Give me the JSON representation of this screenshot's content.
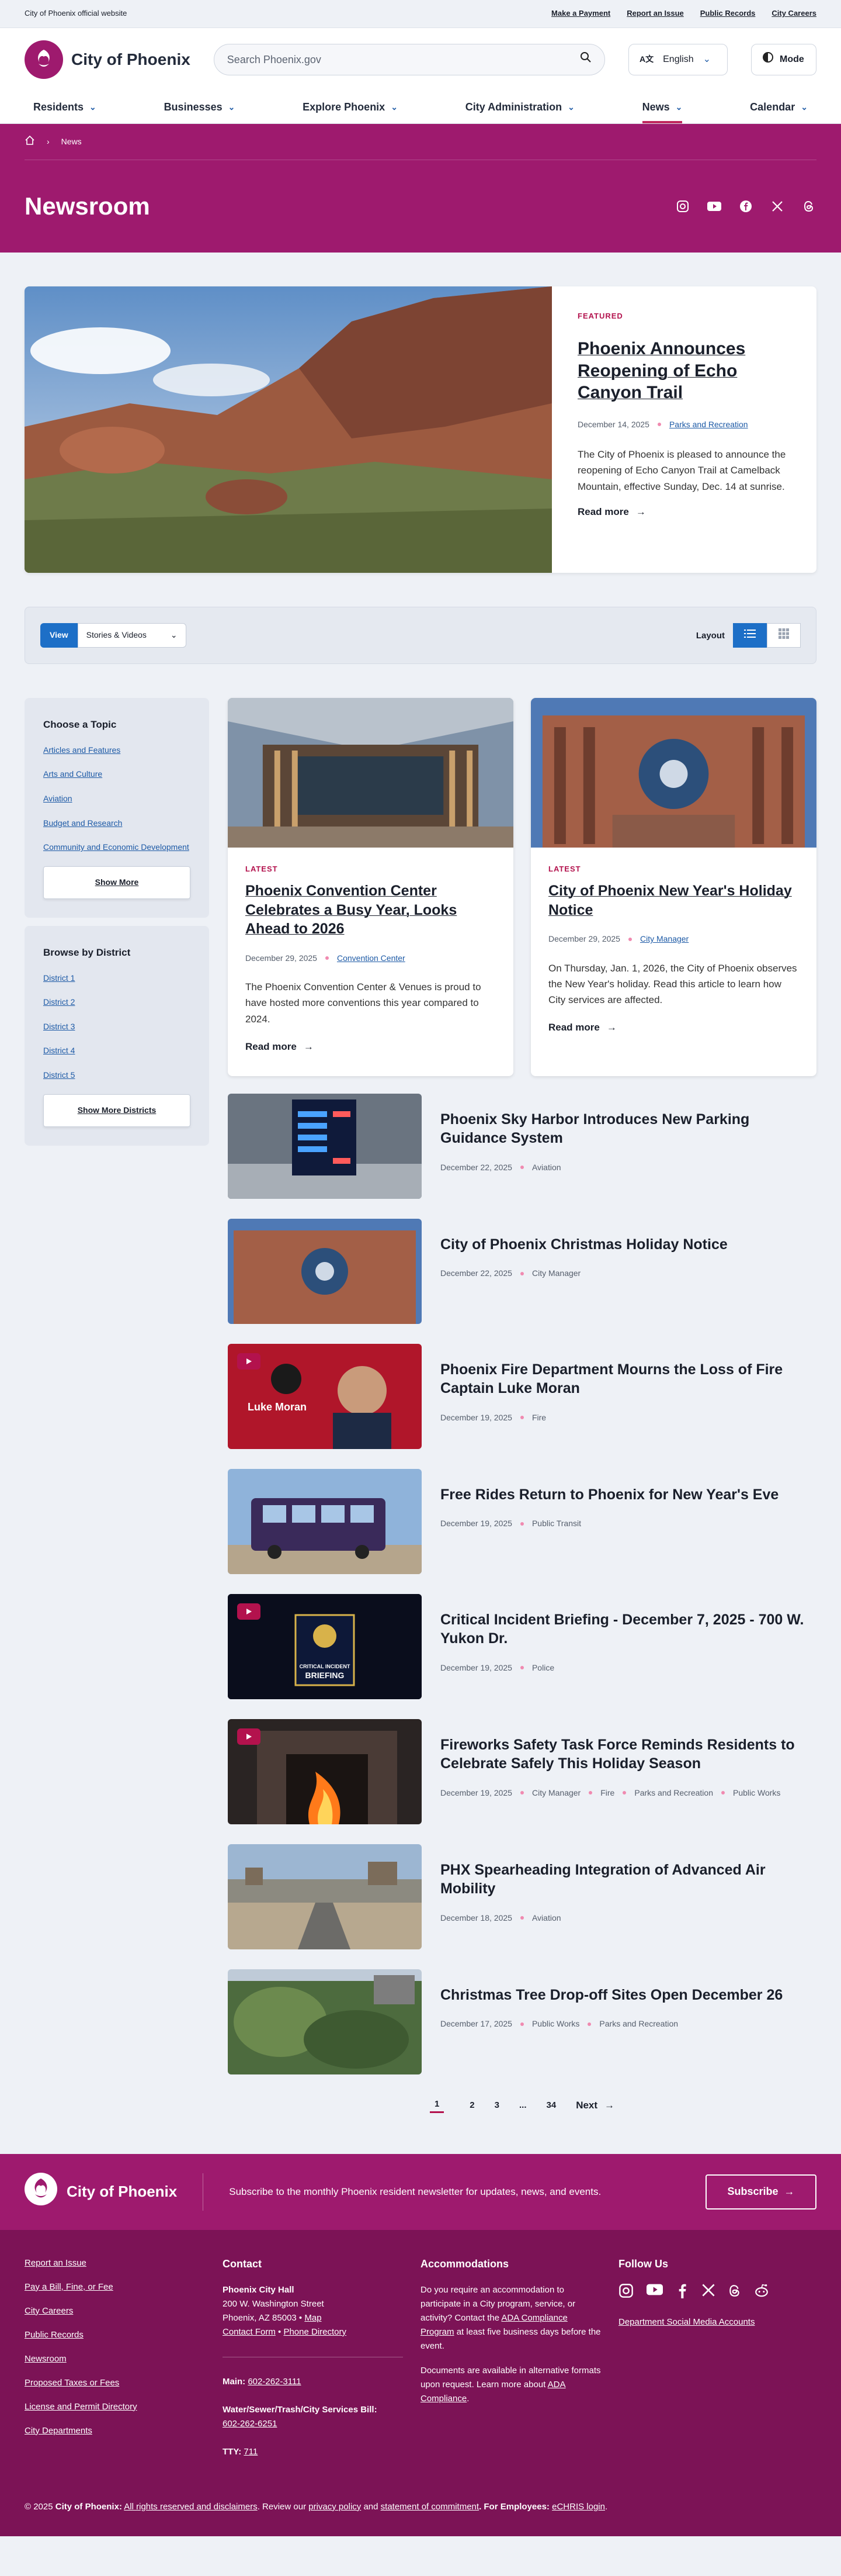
{
  "utility": {
    "official": "City of Phoenix official website",
    "links": [
      "Make a Payment",
      "Report an Issue",
      "Public Records",
      "City Careers"
    ]
  },
  "header": {
    "logo_text": "City of Phoenix",
    "search_placeholder": "Search Phoenix.gov",
    "language": "English",
    "mode_label": "Mode"
  },
  "nav": [
    "Residents",
    "Businesses",
    "Explore Phoenix",
    "City Administration",
    "News",
    "Calendar"
  ],
  "hero": {
    "crumb": "News",
    "title": "Newsroom"
  },
  "featured": {
    "badge": "FEATURED",
    "title": "Phoenix Announces Reopening of Echo Canyon Trail",
    "date": "December 14, 2025",
    "tag": "Parks and Recreation",
    "desc": "The City of Phoenix is pleased to announce the reopening of Echo Canyon Trail at Camelback Mountain, effective Sunday, Dec. 14 at sunrise.",
    "read_more": "Read more"
  },
  "filter": {
    "view_label": "View",
    "view_value": "Stories & Videos",
    "layout_label": "Layout"
  },
  "topics": {
    "title": "Choose a Topic",
    "items": [
      "Articles and Features",
      "Arts and Culture",
      "Aviation",
      "Budget and Research",
      "Community and Economic Development"
    ],
    "button": "Show More"
  },
  "districts": {
    "title": "Browse by District",
    "items": [
      "District 1",
      "District 2",
      "District 3",
      "District 4",
      "District 5"
    ],
    "button": "Show More Districts"
  },
  "cards": [
    {
      "badge": "LATEST",
      "title": "Phoenix Convention Center Celebrates a Busy Year, Looks Ahead to 2026",
      "date": "December 29, 2025",
      "tag": "Convention Center",
      "desc": "The Phoenix Convention Center & Venues is proud to have hosted more conventions this year compared to 2024.",
      "read_more": "Read more"
    },
    {
      "badge": "LATEST",
      "title": "City of Phoenix New Year's Holiday Notice",
      "date": "December 29, 2025",
      "tag": "City Manager",
      "desc": "On Thursday, Jan. 1, 2026, the City of Phoenix observes the New Year's holiday. Read this article to learn how City services are affected.",
      "read_more": "Read more"
    }
  ],
  "list": [
    {
      "title": "Phoenix Sky Harbor Introduces New Parking Guidance System",
      "date": "December 22, 2025",
      "tags": [
        "Aviation"
      ]
    },
    {
      "title": "City of Phoenix Christmas Holiday Notice",
      "date": "December 22, 2025",
      "tags": [
        "City Manager"
      ]
    },
    {
      "title": "Phoenix Fire Department Mourns the Loss of Fire Captain Luke Moran",
      "date": "December 19, 2025",
      "tags": [
        "Fire"
      ],
      "thumb_text": "Luke Moran"
    },
    {
      "title": "Free Rides Return to Phoenix for New Year's Eve",
      "date": "December 19, 2025",
      "tags": [
        "Public Transit"
      ]
    },
    {
      "title": "Critical Incident Briefing - December 7, 2025 - 700 W. Yukon Dr.",
      "date": "December 19, 2025",
      "tags": [
        "Police"
      ],
      "thumb_text": "CRITICAL INCIDENT",
      "thumb_text2": "BRIEFING"
    },
    {
      "title": "Fireworks Safety Task Force Reminds Residents to Celebrate Safely This Holiday Season",
      "date": "December 19, 2025",
      "tags": [
        "City Manager",
        "Fire",
        "Parks and Recreation",
        "Public Works"
      ]
    },
    {
      "title": "PHX Spearheading Integration of Advanced Air Mobility",
      "date": "December 18, 2025",
      "tags": [
        "Aviation"
      ]
    },
    {
      "title": "Christmas Tree Drop-off Sites Open December 26",
      "date": "December 17, 2025",
      "tags": [
        "Public Works",
        "Parks and Recreation"
      ]
    }
  ],
  "pager": {
    "pages": [
      "1",
      "2",
      "3",
      "...",
      "34"
    ],
    "next": "Next"
  },
  "footer": {
    "logo_text": "City of Phoenix",
    "subscribe_msg": "Subscribe to the monthly Phoenix resident newsletter for updates, news, and events.",
    "subscribe_btn": "Subscribe",
    "links": [
      "Report an Issue",
      "Pay a Bill, Fine, or Fee",
      "City Careers",
      "Public Records",
      "Newsroom",
      "Proposed Taxes or Fees",
      "License and Permit Directory",
      "City Departments"
    ],
    "contact": {
      "heading": "Contact",
      "name": "Phoenix City Hall",
      "addr1": "200 W. Washington Street",
      "addr2": "Phoenix, AZ 85003",
      "map": "Map",
      "contact_form": "Contact Form",
      "phone_dir": "Phone Directory",
      "main_label": "Main:",
      "main_phone": "602-262-3111",
      "water_label": "Water/Sewer/Trash/City Services Bill:",
      "water_phone": "602-262-6251",
      "tty_label": "TTY:",
      "tty": "711"
    },
    "accommodations": {
      "heading": "Accommodations",
      "p1": "Do you require an accommodation to participate in a City program, service, or activity? Contact the",
      "p1_link": "ADA Compliance Program",
      "p1_end": "at least five business days before the event.",
      "p2": "Documents are available in alternative formats upon request. Learn more about",
      "p2_link": "ADA Compliance"
    },
    "follow": {
      "heading": "Follow Us",
      "link": "Department Social Media Accounts"
    },
    "bottom": {
      "copy": "© 2025",
      "org": "City of Phoenix:",
      "rights": "All rights reserved and disclaimers",
      "review": ". Review our",
      "privacy": "privacy policy",
      "and": "and",
      "statement": "statement of commitment",
      "emp": ". For Employees:",
      "echris": "eCHRIS login"
    }
  }
}
